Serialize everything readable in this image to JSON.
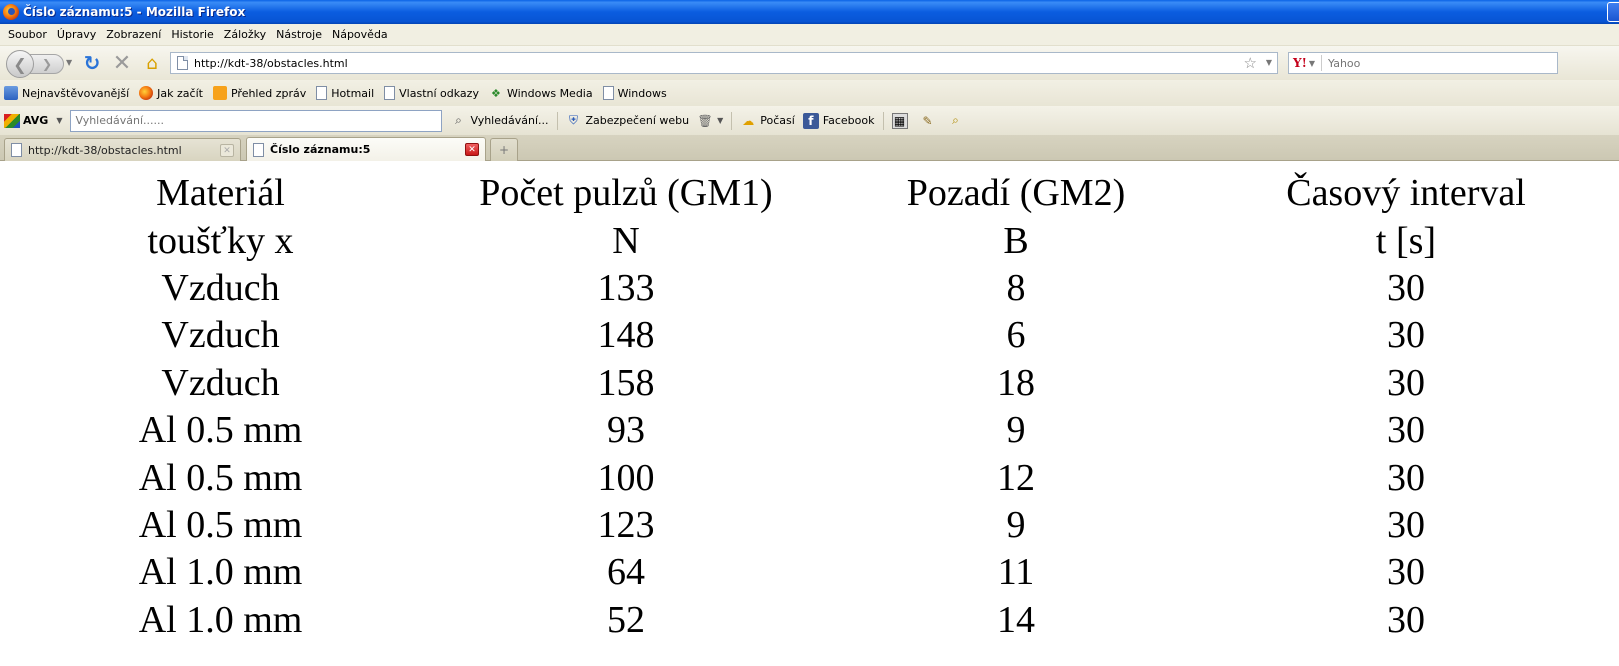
{
  "window": {
    "title": "Číslo záznamu:5 - Mozilla Firefox"
  },
  "menu": {
    "items": [
      "Soubor",
      "Úpravy",
      "Zobrazení",
      "Historie",
      "Záložky",
      "Nástroje",
      "Nápověda"
    ]
  },
  "nav": {
    "url": "http://kdt-38/obstacles.html",
    "search_placeholder": "Yahoo"
  },
  "bookmarks": {
    "items": [
      {
        "label": "Nejnavštěvovanější",
        "icon": "folder-icon"
      },
      {
        "label": "Jak začít",
        "icon": "firefox-icon"
      },
      {
        "label": "Přehled zpráv",
        "icon": "rss-icon"
      },
      {
        "label": "Hotmail",
        "icon": "page-icon"
      },
      {
        "label": "Vlastní odkazy",
        "icon": "page-icon"
      },
      {
        "label": "Windows Media",
        "icon": "windows-icon"
      },
      {
        "label": "Windows",
        "icon": "page-icon"
      }
    ]
  },
  "avg_toolbar": {
    "logo": "AVG",
    "search_placeholder": "Vyhledávání......",
    "search_button": "Vyhledávání...",
    "security": "Zabezpečení webu",
    "weather": "Počasí",
    "facebook": "Facebook"
  },
  "tabs": [
    {
      "label": "http://kdt-38/obstacles.html",
      "active": false
    },
    {
      "label": "Číslo záznamu:5",
      "active": true
    }
  ],
  "table": {
    "header_row1": [
      "Materiál",
      "Počet pulzů (GM1)",
      "Pozadí (GM2)",
      "Časový interval"
    ],
    "header_row2": [
      "toušťky x",
      "N",
      "B",
      "t [s]"
    ],
    "rows": [
      [
        "Vzduch",
        "133",
        "8",
        "30"
      ],
      [
        "Vzduch",
        "148",
        "6",
        "30"
      ],
      [
        "Vzduch",
        "158",
        "18",
        "30"
      ],
      [
        "Al 0.5 mm",
        "93",
        "9",
        "30"
      ],
      [
        "Al 0.5 mm",
        "100",
        "12",
        "30"
      ],
      [
        "Al 0.5 mm",
        "123",
        "9",
        "30"
      ],
      [
        "Al 1.0 mm",
        "64",
        "11",
        "30"
      ],
      [
        "Al 1.0 mm",
        "52",
        "14",
        "30"
      ]
    ]
  }
}
